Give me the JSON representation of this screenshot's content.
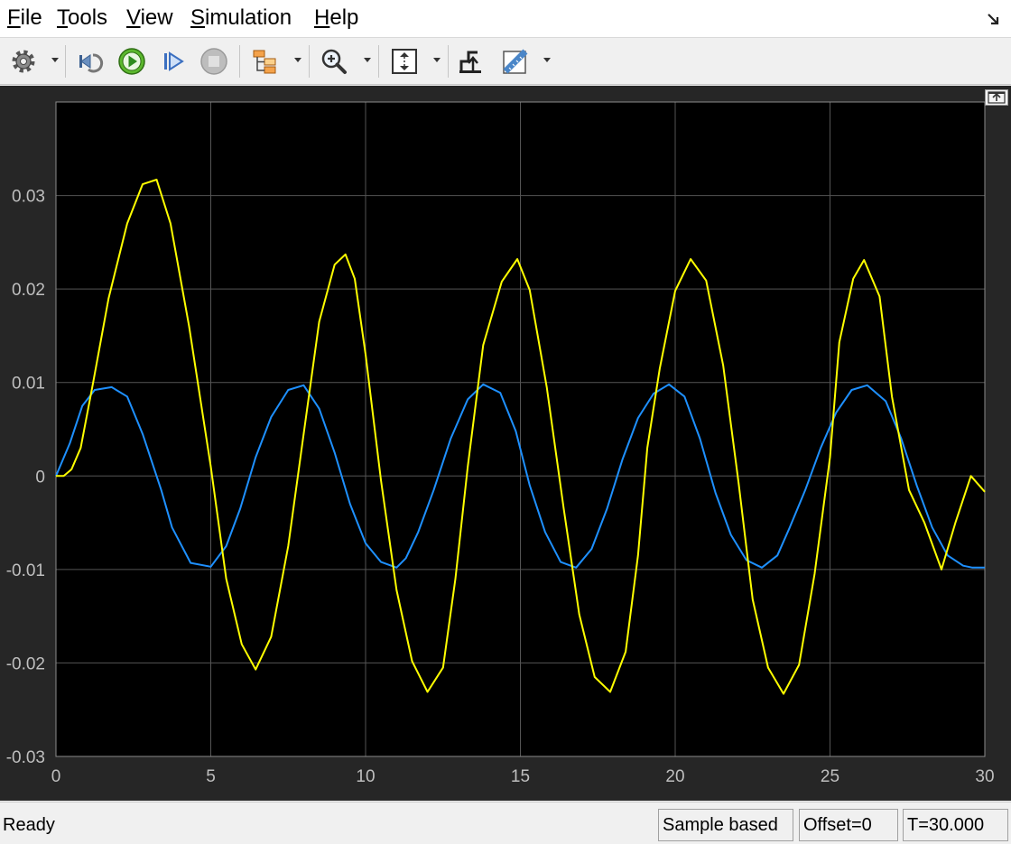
{
  "menu": {
    "items": [
      {
        "label": "File",
        "mnemonic": "F",
        "rest": "ile"
      },
      {
        "label": "Tools",
        "mnemonic": "T",
        "rest": "ools"
      },
      {
        "label": "View",
        "mnemonic": "V",
        "rest": "iew"
      },
      {
        "label": "Simulation",
        "mnemonic": "S",
        "rest": "imulation"
      },
      {
        "label": "Help",
        "mnemonic": "H",
        "rest": "elp"
      }
    ]
  },
  "toolbar": {
    "icons": [
      "gear-icon",
      "step-back-icon",
      "run-icon",
      "step-forward-icon",
      "stop-icon",
      "signal-tree-icon",
      "zoom-in-icon",
      "autoscale-icon",
      "trigger-icon",
      "measure-icon"
    ]
  },
  "status": {
    "text": "Ready",
    "mode": "Sample based",
    "offset": "Offset=0",
    "time": "T=30.000"
  },
  "colors": {
    "plot_bg": "#000000",
    "frame_bg": "#262626",
    "grid": "#555555",
    "axis_text": "#bfbfbf",
    "series_yellow": "#ffff00",
    "series_blue": "#1e90ff"
  },
  "chart_data": {
    "type": "line",
    "xlim": [
      0,
      30
    ],
    "ylim": [
      -0.03,
      0.04
    ],
    "xticks": [
      0,
      5,
      10,
      15,
      20,
      25,
      30
    ],
    "xtick_labels": [
      "0",
      "5",
      "10",
      "15",
      "20",
      "25",
      "30"
    ],
    "yticks": [
      -0.03,
      -0.02,
      -0.01,
      0,
      0.01,
      0.02,
      0.03
    ],
    "ytick_labels": [
      "-0.03",
      "-0.02",
      "-0.01",
      "0",
      "0.01",
      "0.02",
      "0.03"
    ],
    "grid": true,
    "series": [
      {
        "color": "#ffff00",
        "x": [
          0,
          0.25,
          0.5,
          0.8,
          1.2,
          1.7,
          2.3,
          2.8,
          3.25,
          3.7,
          4.3,
          5.0,
          5.5,
          6.0,
          6.45,
          6.95,
          7.5,
          8.0,
          8.5,
          9.0,
          9.35,
          9.65,
          10.0,
          10.5,
          11.0,
          11.5,
          12.0,
          12.5,
          12.9,
          13.3,
          13.8,
          14.4,
          14.9,
          15.3,
          15.85,
          16.4,
          16.9,
          17.4,
          17.9,
          18.4,
          18.8,
          19.1,
          19.5,
          20.0,
          20.5,
          21.0,
          21.55,
          22.05,
          22.5,
          23.0,
          23.5,
          24.0,
          24.5,
          25.0,
          25.3,
          25.75,
          26.1,
          26.6,
          27.0,
          27.55,
          28.05,
          28.6,
          29.05,
          29.55,
          30.0
        ],
        "y": [
          0.0,
          0.0,
          0.0007,
          0.003,
          0.01,
          0.019,
          0.027,
          0.0312,
          0.0317,
          0.027,
          0.016,
          0.001,
          -0.011,
          -0.018,
          -0.0207,
          -0.0172,
          -0.0075,
          0.0045,
          0.0165,
          0.0226,
          0.0237,
          0.0211,
          0.013,
          -0.0005,
          -0.0122,
          -0.0198,
          -0.0231,
          -0.0205,
          -0.011,
          0.001,
          0.014,
          0.0208,
          0.0232,
          0.0199,
          0.0095,
          -0.0035,
          -0.0148,
          -0.0215,
          -0.0231,
          -0.0188,
          -0.0085,
          0.003,
          0.0115,
          0.0198,
          0.0232,
          0.0209,
          0.0118,
          -0.0008,
          -0.0132,
          -0.0205,
          -0.0233,
          -0.0202,
          -0.0105,
          0.002,
          0.0143,
          0.0211,
          0.0231,
          0.0192,
          0.0085,
          -0.0015,
          -0.005,
          -0.01,
          -0.005,
          0.0,
          -0.0017
        ]
      },
      {
        "color": "#1e90ff",
        "x": [
          0,
          0.45,
          0.85,
          1.25,
          1.8,
          2.3,
          2.8,
          3.4,
          3.75,
          4.35,
          5.0,
          5.5,
          5.95,
          6.45,
          6.95,
          7.5,
          8.0,
          8.5,
          9.0,
          9.5,
          10.0,
          10.5,
          11.0,
          11.3,
          11.7,
          12.2,
          12.75,
          13.3,
          13.8,
          14.35,
          14.85,
          15.3,
          15.8,
          16.3,
          16.8,
          17.3,
          17.8,
          18.3,
          18.8,
          19.3,
          19.8,
          20.3,
          20.8,
          21.3,
          21.8,
          22.3,
          22.8,
          23.3,
          23.7,
          24.2,
          24.7,
          25.2,
          25.7,
          26.2,
          26.8,
          27.3,
          27.8,
          28.3,
          28.8,
          29.3,
          29.6,
          30.0
        ],
        "y": [
          0.0,
          0.0035,
          0.0075,
          0.0092,
          0.0095,
          0.0085,
          0.0045,
          -0.0015,
          -0.0055,
          -0.0093,
          -0.0097,
          -0.0075,
          -0.0035,
          0.002,
          0.0063,
          0.0092,
          0.0097,
          0.0072,
          0.0025,
          -0.003,
          -0.0072,
          -0.0092,
          -0.0098,
          -0.0088,
          -0.006,
          -0.0015,
          0.004,
          0.0082,
          0.0098,
          0.0089,
          0.0048,
          -0.001,
          -0.006,
          -0.0092,
          -0.0098,
          -0.0078,
          -0.0035,
          0.0018,
          0.0062,
          0.0088,
          0.0098,
          0.0085,
          0.004,
          -0.0018,
          -0.0063,
          -0.009,
          -0.0098,
          -0.0085,
          -0.0055,
          -0.0015,
          0.003,
          0.0068,
          0.0092,
          0.0097,
          0.008,
          0.004,
          -0.001,
          -0.0055,
          -0.0085,
          -0.0096,
          -0.0098,
          -0.0098
        ]
      }
    ]
  }
}
